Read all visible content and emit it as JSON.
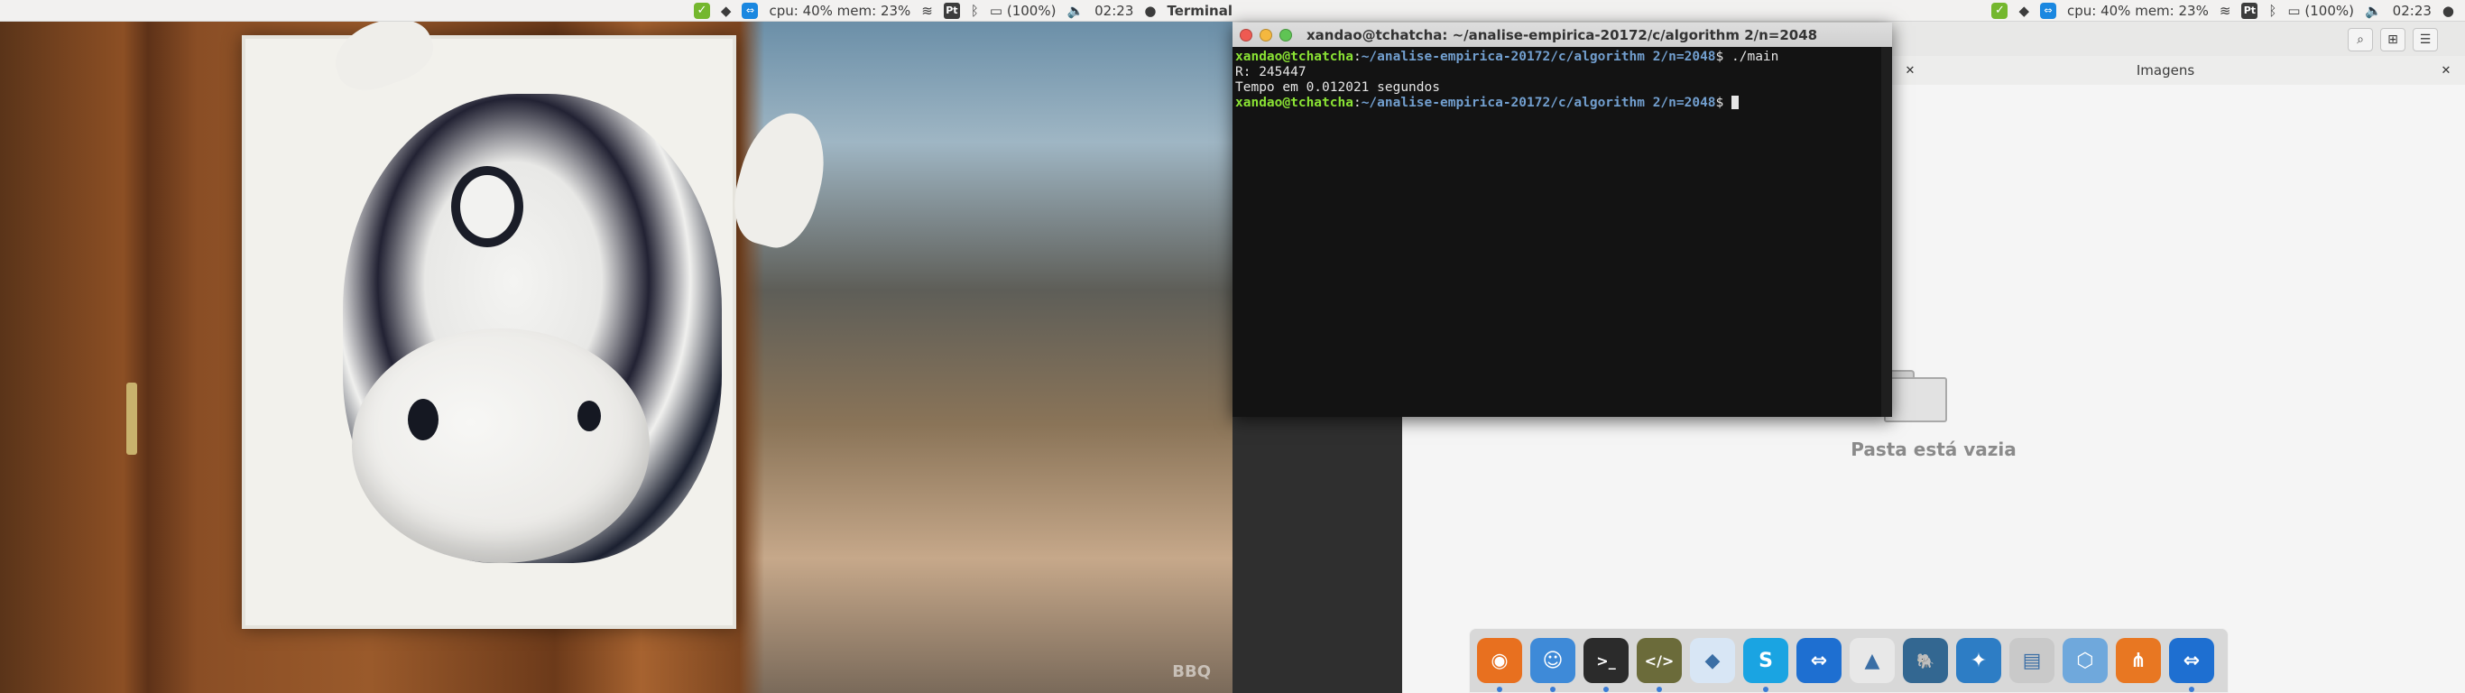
{
  "topbar": {
    "cpu_mem": "cpu: 40% mem: 23%",
    "battery": "(100%)",
    "time": "02:23",
    "active_app": "Terminal",
    "pt_badge": "Pt"
  },
  "terminal": {
    "title": "xandao@tchatcha: ~/analise-empirica-20172/c/algorithm 2/n=2048",
    "lines": [
      {
        "user": "xandao@tchatcha",
        "path": "~/analise-empirica-20172/c/algorithm 2/n=2048",
        "cmd": "./main"
      },
      {
        "text": "R: 245447"
      },
      {
        "text": "Tempo em 0.012021 segundos"
      },
      {
        "user": "xandao@tchatcha",
        "path": "~/analise-empirica-20172/c/algorithm 2/n=2048",
        "cmd": ""
      }
    ]
  },
  "filemanager": {
    "tab_title": "Imagens",
    "empty_message": "Pasta está vazia"
  },
  "photo": {
    "watermark": "BBQ"
  },
  "dock": {
    "items": [
      {
        "name": "firefox",
        "color": "#e8701f",
        "glyph": "◉"
      },
      {
        "name": "finder",
        "color": "#3e8ad8",
        "glyph": "☺"
      },
      {
        "name": "terminal",
        "color": "#2b2b2b",
        "glyph": ">_"
      },
      {
        "name": "code-editor",
        "color": "#6b6b3a",
        "glyph": "</>"
      },
      {
        "name": "dropbox",
        "color": "#d8e6f5",
        "glyph": "◆"
      },
      {
        "name": "skype",
        "color": "#1aa4e2",
        "glyph": "S"
      },
      {
        "name": "teamviewer",
        "color": "#1e6fd1",
        "glyph": "⇔"
      },
      {
        "name": "matlab",
        "color": "#e8e8e8",
        "glyph": "▲"
      },
      {
        "name": "postgresql",
        "color": "#336791",
        "glyph": "🐘"
      },
      {
        "name": "mysql-workbench",
        "color": "#2d7dc5",
        "glyph": "✦"
      },
      {
        "name": "scanner",
        "color": "#c9c9c9",
        "glyph": "▤"
      },
      {
        "name": "virtualbox",
        "color": "#6fa8dc",
        "glyph": "⬡"
      },
      {
        "name": "network-app",
        "color": "#e87722",
        "glyph": "⋔"
      },
      {
        "name": "teamviewer-2",
        "color": "#1e6fd1",
        "glyph": "⇔"
      }
    ]
  },
  "colors": {
    "prompt_user": "#8ae234",
    "prompt_path": "#729fcf",
    "close": "#ee5a52",
    "minimize": "#f4b83f",
    "maximize": "#5fc454"
  }
}
